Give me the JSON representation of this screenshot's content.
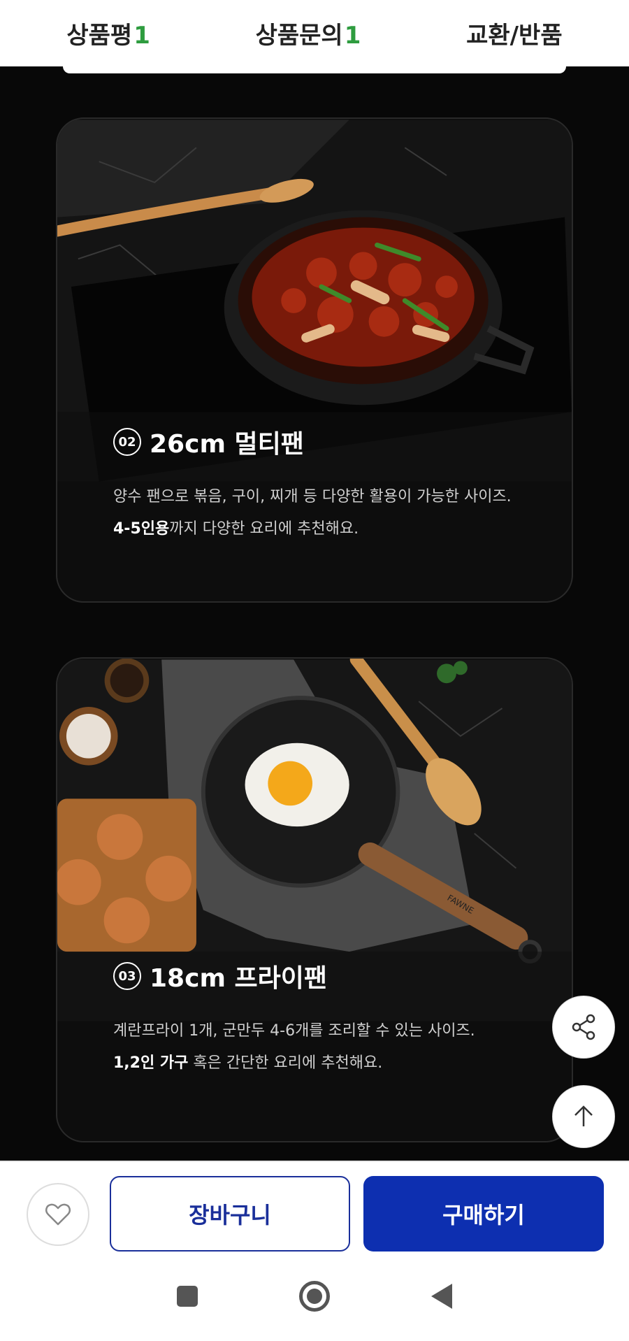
{
  "tabs": [
    {
      "label": "상품평",
      "count": "1"
    },
    {
      "label": "상품문의",
      "count": "1"
    },
    {
      "label": "교환/반품",
      "count": ""
    }
  ],
  "cards": [
    {
      "number": "02",
      "title": "26cm 멀티팬",
      "desc_line1": "양수 팬으로 볶음, 구이, 찌개 등 다양한 활용이 가능한 사이즈.",
      "desc_line2_bold": "4-5인용",
      "desc_line2_rest": "까지 다양한 요리에 추천해요."
    },
    {
      "number": "03",
      "title": "18cm 프라이팬",
      "desc_line1": "계란프라이 1개, 군만두 4-6개를 조리할 수 있는 사이즈.",
      "desc_line2_bold": "1,2인 가구",
      "desc_line2_rest": " 혹은 간단한 요리에 추천해요.",
      "handle_brand": "FAWNE"
    }
  ],
  "bottom_bar": {
    "cart_label": "장바구니",
    "buy_label": "구매하기"
  },
  "colors": {
    "accent_green": "#2e9c3f",
    "primary_blue": "#0d2fb0"
  }
}
